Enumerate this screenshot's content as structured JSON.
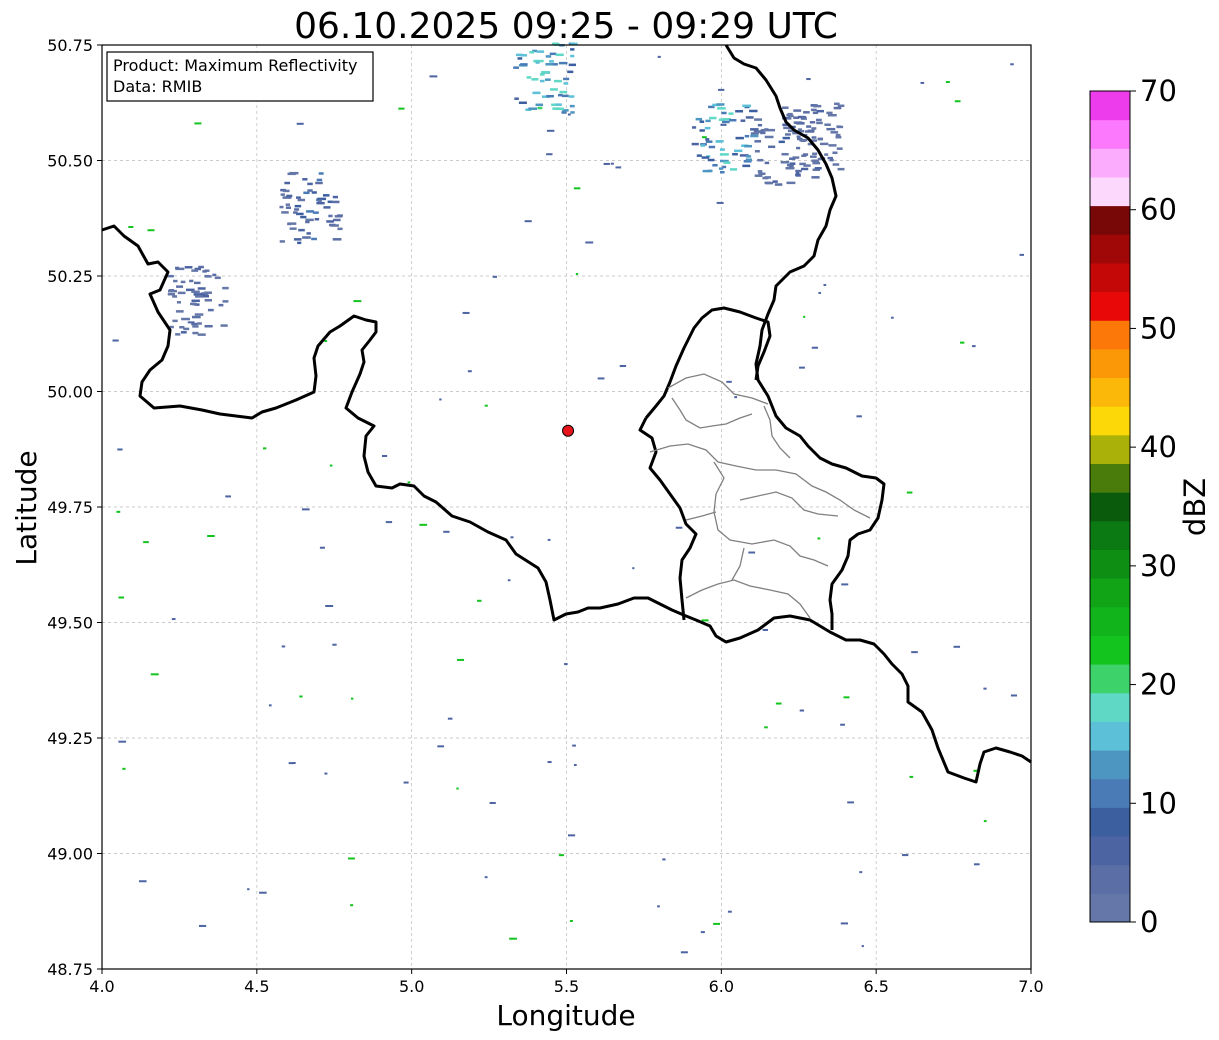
{
  "title": "06.10.2025 09:25 - 09:29 UTC",
  "info_box": {
    "product": "Product: Maximum Reflectivity",
    "data": "Data: RMIB"
  },
  "chart_data": {
    "type": "heatmap",
    "title": "06.10.2025 09:25 - 09:29 UTC",
    "xlabel": "Longitude",
    "ylabel": "Latitude",
    "xlim": [
      4.0,
      7.0
    ],
    "ylim": [
      48.75,
      50.75
    ],
    "x_ticks": [
      "4.0",
      "4.5",
      "5.0",
      "5.5",
      "6.0",
      "6.5",
      "7.0"
    ],
    "y_ticks": [
      "48.75",
      "49.00",
      "49.25",
      "49.50",
      "49.75",
      "50.00",
      "50.25",
      "50.50",
      "50.75"
    ],
    "grid": true,
    "radar_site": {
      "lon": 5.505,
      "lat": 49.915,
      "color": "#e8141c"
    },
    "colorbar": {
      "label": "dBZ",
      "min": 0,
      "max": 70,
      "ticks": [
        "0",
        "10",
        "20",
        "30",
        "40",
        "50",
        "60",
        "70"
      ],
      "colors": [
        "#6477a8",
        "#5b6fa6",
        "#4d64a3",
        "#3c5fa0",
        "#4a7bb6",
        "#4e96c2",
        "#5cc0d8",
        "#5fd8c6",
        "#3dd36a",
        "#14c41e",
        "#12b41c",
        "#10a416",
        "#0e8f14",
        "#0c7a12",
        "#0a5c0c",
        "#4a7c0c",
        "#aab20a",
        "#fcd808",
        "#fbb808",
        "#fb9808",
        "#fc7808",
        "#e80808",
        "#c40808",
        "#a00808",
        "#780808",
        "#fcd8fc",
        "#fcacfc",
        "#fc78fc",
        "#ec3cec"
      ]
    },
    "echo_cells": [
      {
        "lon": 4.3,
        "lat": 50.2,
        "dbz": 8
      },
      {
        "lon": 4.67,
        "lat": 50.4,
        "dbz": 12
      },
      {
        "lon": 5.42,
        "lat": 50.68,
        "dbz": 22
      },
      {
        "lon": 6.0,
        "lat": 50.55,
        "dbz": 20
      },
      {
        "lon": 6.2,
        "lat": 50.52,
        "dbz": 10
      },
      {
        "lon": 6.28,
        "lat": 50.55,
        "dbz": 8
      }
    ]
  },
  "colors": {
    "border": "#000000",
    "regions": "#808080",
    "grid": "#bbbbbb"
  }
}
